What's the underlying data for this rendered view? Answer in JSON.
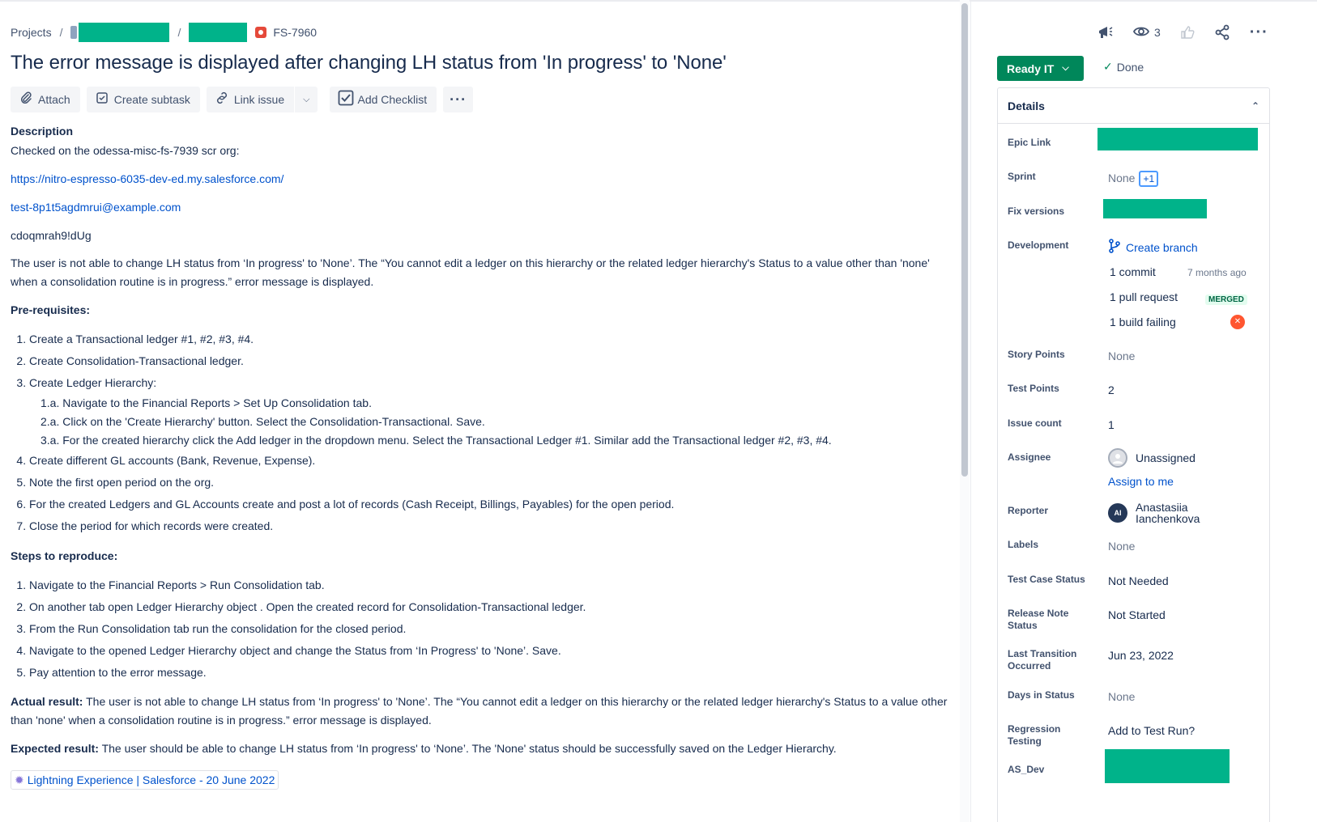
{
  "breadcrumb": {
    "projects": "Projects",
    "separator": "/",
    "issue_key": "FS-7960"
  },
  "title": "The error message is displayed after changing LH status from 'In progress' to 'None'",
  "toolbar": {
    "attach": "Attach",
    "create_subtask": "Create subtask",
    "link_issue": "Link issue",
    "add_checklist": "Add Checklist"
  },
  "description": {
    "heading": "Description",
    "checked_on": "Checked on the odessa-misc-fs-7939 scr org:",
    "url": "https://nitro-espresso-6035-dev-ed.my.salesforce.com/",
    "email": "test-8p1t5agdmrui@example.com",
    "password": "cdoqmrah9!dUg",
    "summary": "The user is not able to change LH status from ‘In progress' to 'None’. The “You cannot edit a ledger on this hierarchy or the related ledger hierarchy's Status to a value other than 'none' when a consolidation routine is in progress.” error message is displayed.",
    "prereq_heading": "Pre-requisites:",
    "prereqs": [
      "Create a Transactional ledger #1, #2, #3, #4.",
      "Create Consolidation-Transactional ledger.",
      "Create Ledger Hierarchy:",
      "Create different GL accounts (Bank, Revenue, Expense).",
      "Note the first open period on the org.",
      "For the created Ledgers and GL Accounts create and post a lot of records (Cash Receipt, Billings, Payables) for the open period.",
      "Close the period for which records were created."
    ],
    "prereq_substeps": [
      "1.a. Navigate to the Financial Reports > Set Up Consolidation tab.",
      "2.a. Click on the 'Create Hierarchy' button. Select the Consolidation-Transactional. Save.",
      "3.a. For the created hierarchy click the Add ledger in the dropdown menu. Select the Transactional Ledger #1. Similar add the Transactional ledger #2, #3, #4."
    ],
    "steps_heading": "Steps to reproduce:",
    "steps": [
      "Navigate to the Financial Reports > Run Consolidation tab.",
      "On another tab open Ledger Hierarchy object . Open the created record for Consolidation-Transactional ledger.",
      "From the Run Consolidation tab run the consolidation for the closed period.",
      "Navigate to the opened Ledger Hierarchy object and change the Status from ‘In Progress' to 'None’. Save.",
      "Pay attention to the error message."
    ],
    "actual_label": "Actual result:",
    "actual_text": " The user is not able to change LH status from ‘In progress' to 'None’. The “You cannot edit a ledger on this hierarchy or the related ledger hierarchy's Status to a value other than 'none' when a consolidation routine is in progress.” error message is displayed.",
    "expected_label": "Expected result:",
    "expected_text": " The user should be able to change LH status from ‘In progress' to ‘None’. The 'None' status should be successfully saved on the Ledger Hierarchy.",
    "ref_chip": "Lightning Experience | Salesforce - 20 June 2022"
  },
  "side_actions": {
    "watchers": "3"
  },
  "status": {
    "button": "Ready IT",
    "resolution": "Done"
  },
  "details": {
    "heading": "Details",
    "epic_link_label": "Epic Link",
    "sprint_label": "Sprint",
    "sprint_value": "None",
    "sprint_more": "+1",
    "fix_versions_label": "Fix versions",
    "development_label": "Development",
    "create_branch": "Create branch",
    "commit": "1 commit",
    "commit_time": "7 months ago",
    "pull_request": "1 pull request",
    "merged": "MERGED",
    "build": "1 build failing",
    "story_points_label": "Story Points",
    "story_points": "None",
    "test_points_label": "Test Points",
    "test_points": "2",
    "issue_count_label": "Issue count",
    "issue_count": "1",
    "assignee_label": "Assignee",
    "assignee": "Unassigned",
    "assign_to_me": "Assign to me",
    "reporter_label": "Reporter",
    "reporter_initials": "AI",
    "reporter_first": "Anastasiia",
    "reporter_last": "Ianchenkova",
    "labels_label": "Labels",
    "labels": "None",
    "test_case_status_label": "Test Case Status",
    "test_case_status": "Not Needed",
    "release_note_status_label": "Release Note Status",
    "release_note_status": "Not Started",
    "last_transition_label": "Last Transition Occurred",
    "last_transition": "Jun 23, 2022",
    "days_in_status_label": "Days in Status",
    "days_in_status": "None",
    "regression_label": "Regression Testing",
    "regression": "Add to Test Run?",
    "as_dev_label": "AS_Dev"
  }
}
